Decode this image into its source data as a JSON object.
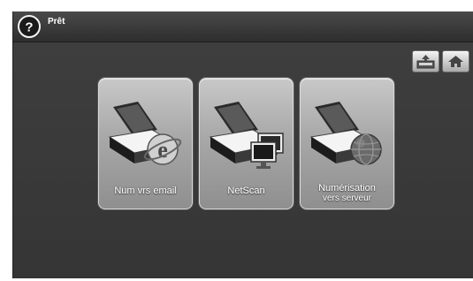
{
  "status_bar": {
    "help_icon": "question-mark-icon",
    "status": "Prêt"
  },
  "toolbar": {
    "job_status_icon": "tray-upload-icon",
    "home_icon": "home-icon"
  },
  "apps": [
    {
      "label": "Num vrs email",
      "icon": "scanner-email-icon"
    },
    {
      "label": "NetScan",
      "icon": "scanner-pc-icon"
    },
    {
      "label": "Numérisation",
      "label_line2": "vers serveur",
      "icon": "scanner-server-icon"
    }
  ]
}
